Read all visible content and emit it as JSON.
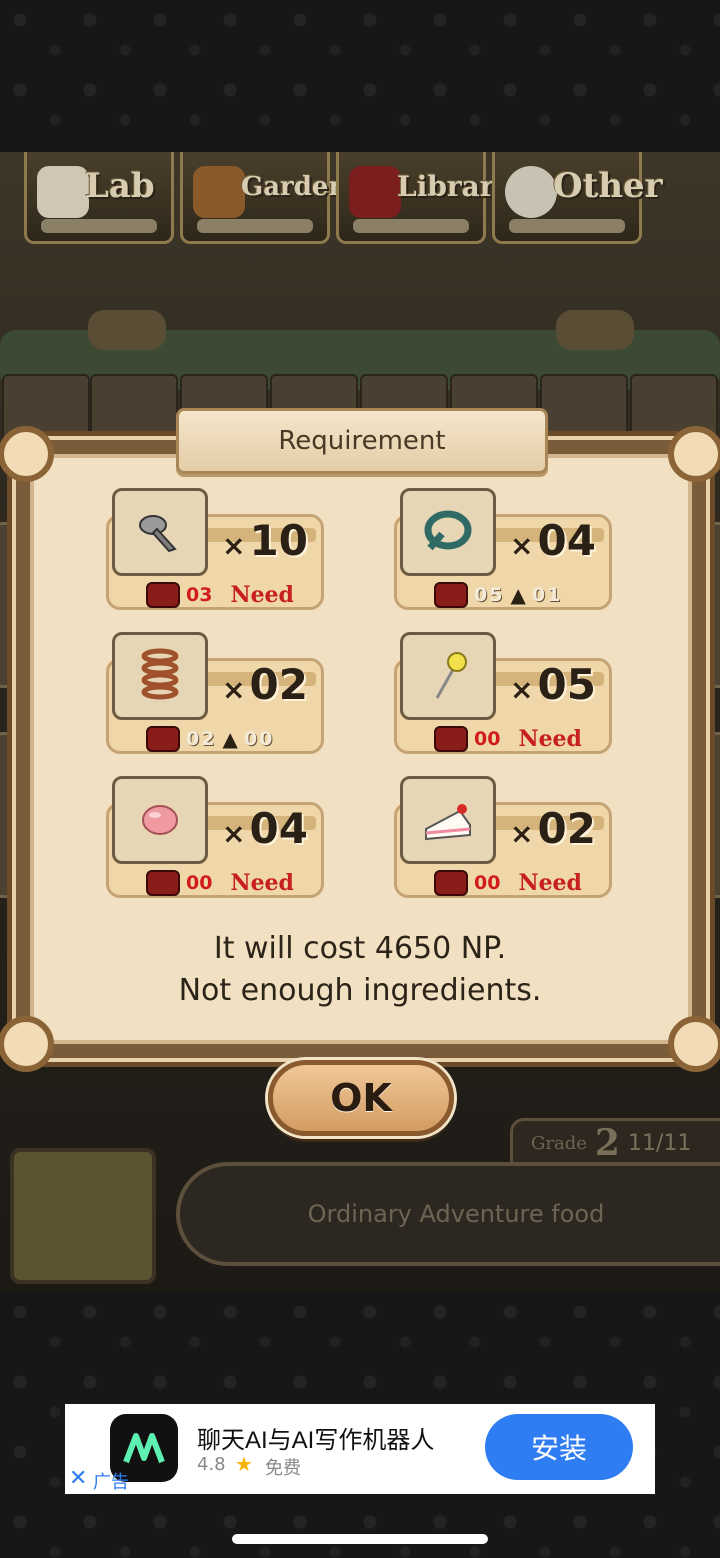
{
  "nav_tabs": [
    {
      "label": "Lab",
      "icon": "skull-icon"
    },
    {
      "label": "Garden",
      "icon": "mushroom-icon"
    },
    {
      "label": "Library",
      "icon": "book-icon"
    },
    {
      "label": "Other",
      "icon": "magnifier-icon"
    }
  ],
  "dialog": {
    "title": "Requirement",
    "ingredients": [
      {
        "icon": "screw-icon",
        "multiplier": "×",
        "qty": "10",
        "have": "03",
        "status": "Need"
      },
      {
        "icon": "hose-icon",
        "multiplier": "×",
        "qty": "04",
        "have": "05",
        "arrow": "▲",
        "after": "01"
      },
      {
        "icon": "spring-icon",
        "multiplier": "×",
        "qty": "02",
        "have": "02",
        "arrow": "▲",
        "after": "00"
      },
      {
        "icon": "lollipop-icon",
        "multiplier": "×",
        "qty": "05",
        "have": "00",
        "status": "Need"
      },
      {
        "icon": "candy-icon",
        "multiplier": "×",
        "qty": "04",
        "have": "00",
        "status": "Need"
      },
      {
        "icon": "cake-icon",
        "multiplier": "×",
        "qty": "02",
        "have": "00",
        "status": "Need"
      }
    ],
    "cost_line": "It will cost 4650 NP.",
    "warning_line": "Not enough ingredients.",
    "ok_label": "OK"
  },
  "item_panel": {
    "grade_label": "Grade",
    "grade_value": "2",
    "count": "11/11",
    "description": "Ordinary Adventure food"
  },
  "ad": {
    "title": "聊天AI与AI写作机器人",
    "rating": "4.8",
    "star": "★",
    "price": "免费",
    "install_label": "安装",
    "close": "✕",
    "tag": "广告"
  },
  "colors": {
    "accent_red": "#d21d1d",
    "dialog_bg": "#f1e0c1",
    "ad_button": "#2f7df2"
  }
}
